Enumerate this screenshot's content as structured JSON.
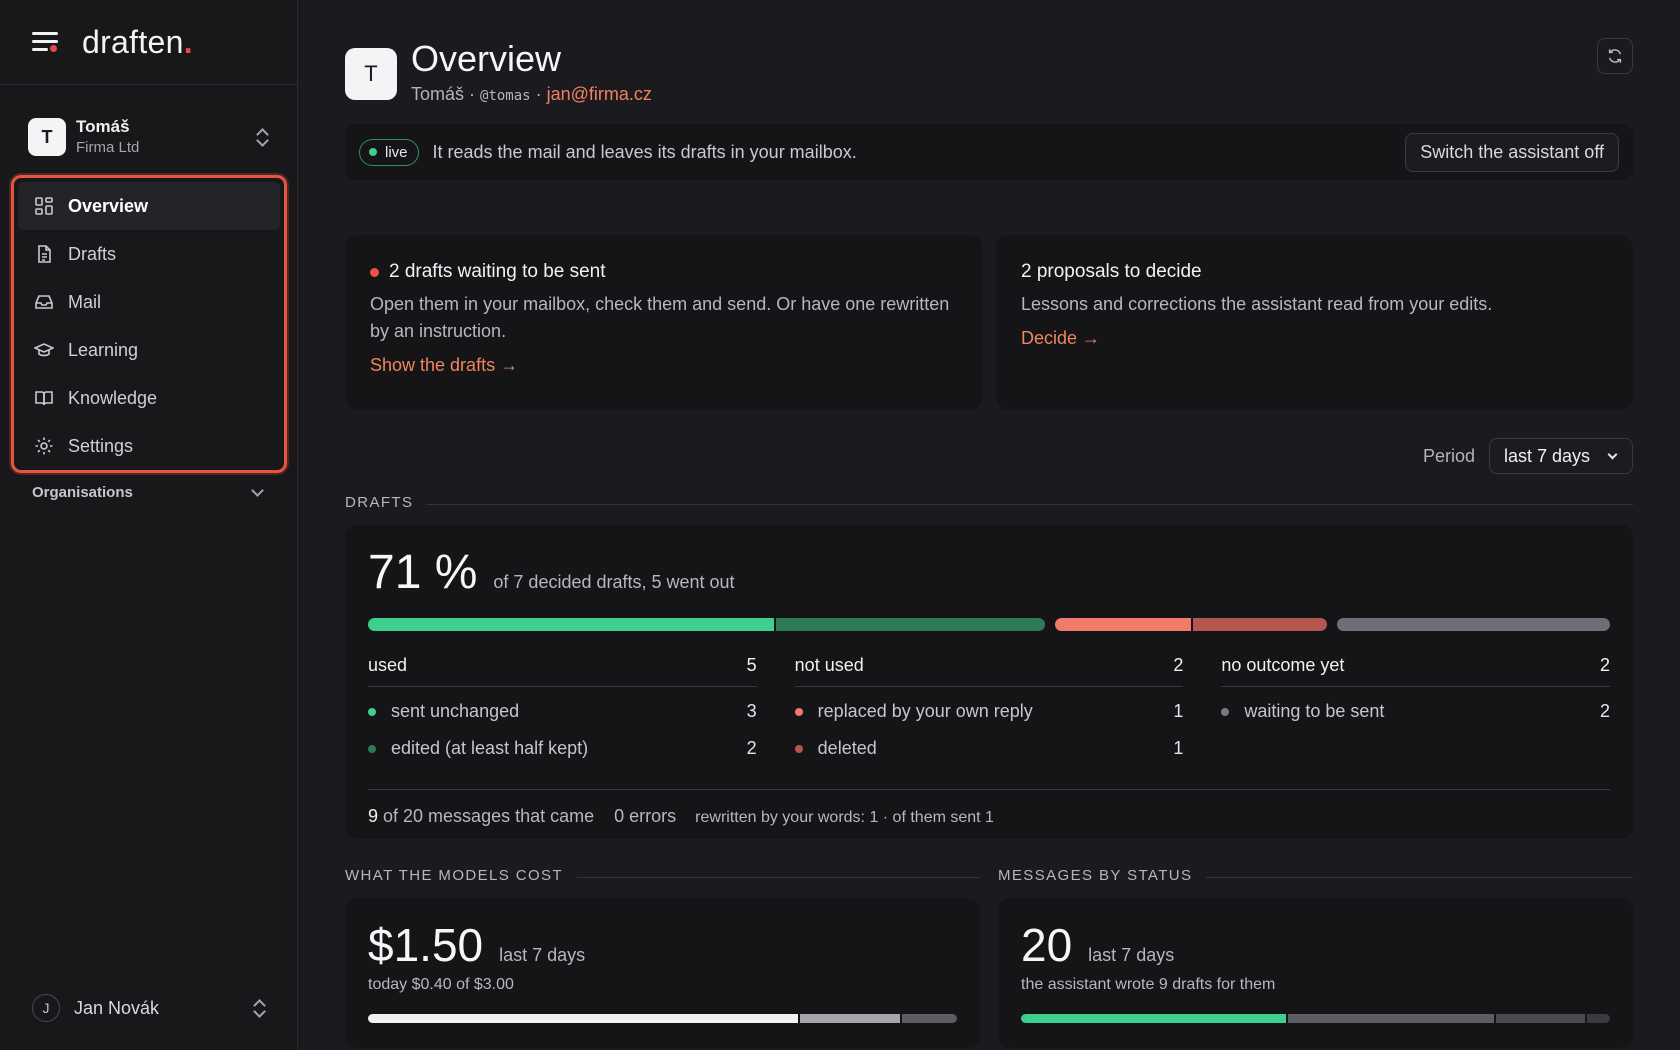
{
  "brand": {
    "name": "draften",
    "dot": "."
  },
  "account": {
    "initial": "T",
    "name": "Tomáš",
    "org": "Firma Ltd"
  },
  "nav": [
    {
      "label": "Overview",
      "icon": "grid-icon",
      "active": true
    },
    {
      "label": "Drafts",
      "icon": "document-icon",
      "active": false
    },
    {
      "label": "Mail",
      "icon": "inbox-icon",
      "active": false
    },
    {
      "label": "Learning",
      "icon": "graduation-cap-icon",
      "active": false
    },
    {
      "label": "Knowledge",
      "icon": "book-icon",
      "active": false
    },
    {
      "label": "Settings",
      "icon": "gear-icon",
      "active": false
    }
  ],
  "organisations_label": "Organisations",
  "user": {
    "initial": "J",
    "name": "Jan Novák"
  },
  "header": {
    "initial": "T",
    "title": "Overview",
    "name": "Tomáš",
    "sep": " · ",
    "handle": "@tomas",
    "email": "jan@firma.cz"
  },
  "status": {
    "pill": "live",
    "message": "It reads the mail and leaves its drafts in your mailbox.",
    "switch_label": "Switch the assistant off"
  },
  "cards": {
    "drafts": {
      "title": "2 drafts waiting to be sent",
      "desc": "Open them in your mailbox, check them and send. Or have one rewritten by an instruction.",
      "link": "Show the drafts →"
    },
    "proposals": {
      "title": "2 proposals to decide",
      "desc": "Lessons and corrections the assistant read from your edits.",
      "link": "Decide →"
    }
  },
  "period": {
    "label": "Period",
    "value": "last 7 days"
  },
  "drafts_section": {
    "heading": "DRAFTS",
    "percent": "71 %",
    "summary": "of 7 decided drafts, 5 went out",
    "columns": [
      {
        "title": "used",
        "total": "5",
        "rows": [
          {
            "label": "sent unchanged",
            "value": "3",
            "color": "#3ecf8e"
          },
          {
            "label": "edited (at least half kept)",
            "value": "2",
            "color": "#2f7a56"
          }
        ]
      },
      {
        "title": "not used",
        "total": "2",
        "rows": [
          {
            "label": "replaced by your own reply",
            "value": "1",
            "color": "#f07b6a"
          },
          {
            "label": "deleted",
            "value": "1",
            "color": "#b5554f"
          }
        ]
      },
      {
        "title": "no outcome yet",
        "total": "2",
        "rows": [
          {
            "label": "waiting to be sent",
            "value": "2",
            "color": "#7a7a82"
          }
        ]
      }
    ],
    "footer": {
      "came_num": "9",
      "came_text": " of 20 messages that came",
      "errors": "0 errors",
      "rewritten": "rewritten by your words: 1 · of them sent 1"
    }
  },
  "cost_section": {
    "heading": "WHAT THE MODELS COST",
    "value": "$1.50",
    "period": "last 7 days",
    "sub": "today $0.40 of $3.00"
  },
  "status_section": {
    "heading": "MESSAGES BY STATUS",
    "value": "20",
    "period": "last 7 days",
    "sub": "the assistant wrote 9 drafts for them"
  },
  "colors": {
    "accent": "#e8553e",
    "link": "#f0845f",
    "live": "#3ecf8e"
  }
}
